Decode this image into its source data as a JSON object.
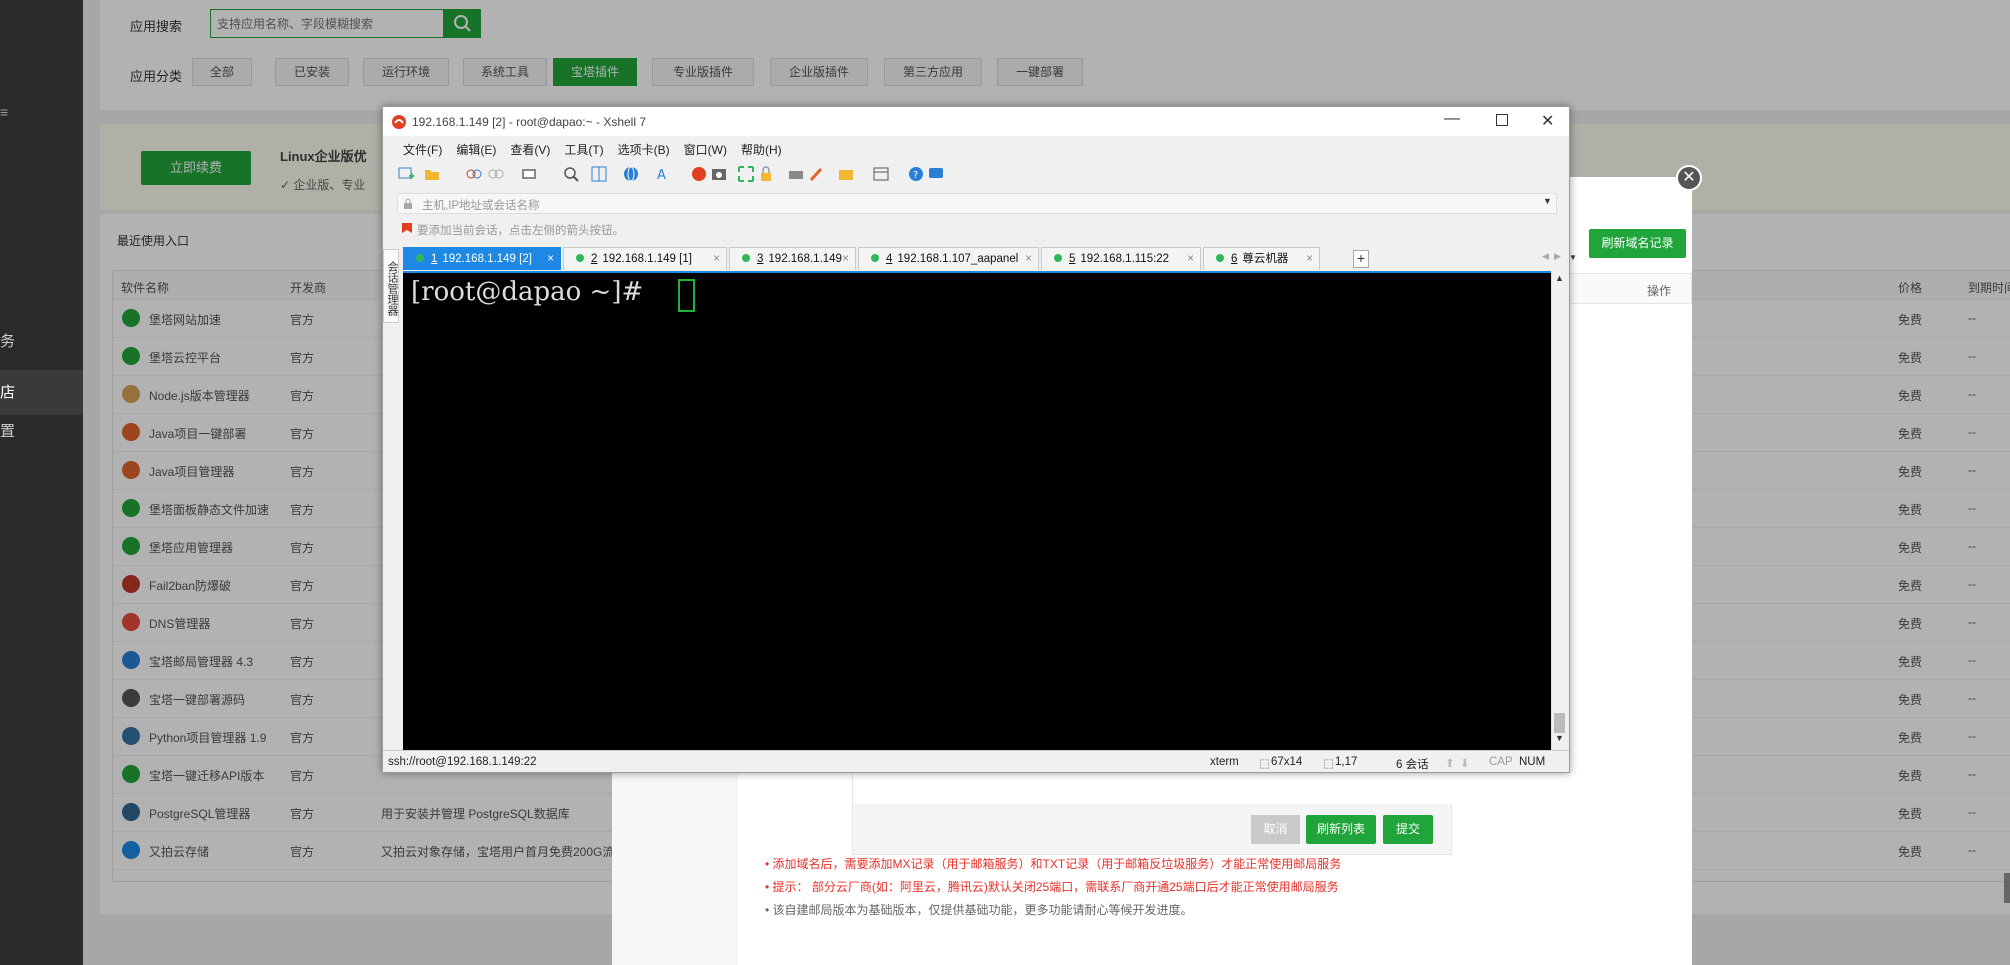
{
  "sidebar": {
    "items": [
      "务",
      "店",
      "置"
    ],
    "top_glyph": "≡"
  },
  "search": {
    "label": "应用搜索",
    "placeholder": "支持应用名称、字段模糊搜索"
  },
  "category": {
    "label": "应用分类",
    "buttons": [
      "全部",
      "已安装",
      "运行环境",
      "系统工具",
      "宝塔插件",
      "专业版插件",
      "企业版插件",
      "第三方应用",
      "一键部署"
    ],
    "active_index": 4
  },
  "promo": {
    "button": "立即续费",
    "title": "Linux企业版优",
    "sub": "✓ 企业版、专业"
  },
  "recent": {
    "label": "最近使用入口"
  },
  "table": {
    "headers": [
      "软件名称",
      "开发商"
    ],
    "right_headers": [
      "价格",
      "到期时间"
    ],
    "rows": [
      {
        "name": "堡塔网站加速",
        "dev": "官方",
        "desc": "",
        "price": "免费",
        "expire": "--",
        "color": "#20a53a"
      },
      {
        "name": "堡塔云控平台",
        "dev": "官方",
        "desc": "",
        "price": "免费",
        "expire": "--",
        "color": "#20a53a"
      },
      {
        "name": "Node.js版本管理器",
        "dev": "官方",
        "desc": "",
        "price": "免费",
        "expire": "--",
        "color": "#d7a35a"
      },
      {
        "name": "Java项目一键部署",
        "dev": "官方",
        "desc": "",
        "price": "免费",
        "expire": "--",
        "color": "#e0642c"
      },
      {
        "name": "Java项目管理器",
        "dev": "官方",
        "desc": "",
        "price": "免费",
        "expire": "--",
        "color": "#e0642c"
      },
      {
        "name": "堡塔面板静态文件加速",
        "dev": "官方",
        "desc": "",
        "price": "免费",
        "expire": "--",
        "color": "#20a53a"
      },
      {
        "name": "堡塔应用管理器",
        "dev": "官方",
        "desc": "",
        "price": "免费",
        "expire": "--",
        "color": "#20a53a"
      },
      {
        "name": "Fail2ban防爆破",
        "dev": "官方",
        "desc": "",
        "price": "免费",
        "expire": "--",
        "color": "#c0392b"
      },
      {
        "name": "DNS管理器",
        "dev": "官方",
        "desc": "",
        "price": "免费",
        "expire": "--",
        "color": "#e74c3c"
      },
      {
        "name": "宝塔邮局管理器 4.3",
        "dev": "官方",
        "desc": "",
        "price": "免费",
        "expire": "--",
        "color": "#2a7fd4"
      },
      {
        "name": "宝塔一键部署源码",
        "dev": "官方",
        "desc": "",
        "price": "免费",
        "expire": "--",
        "color": "#555555"
      },
      {
        "name": "Python项目管理器 1.9",
        "dev": "官方",
        "desc": "",
        "price": "免费",
        "expire": "--",
        "color": "#3572a5"
      },
      {
        "name": "宝塔一键迁移API版本",
        "dev": "官方",
        "desc": "",
        "price": "免费",
        "expire": "--",
        "color": "#20a53a"
      },
      {
        "name": "PostgreSQL管理器",
        "dev": "官方",
        "desc": "用于安装并管理 PostgreSQL数据库",
        "price": "免费",
        "expire": "--",
        "color": "#336791"
      },
      {
        "name": "又拍云存储",
        "dev": "官方",
        "desc": "又拍云对象存储，宝塔用户首月免费200G流",
        "price": "免费",
        "expire": "--",
        "color": "#1e88e5"
      }
    ]
  },
  "dialog": {
    "refresh_domain": "刷新域名记录",
    "op_header": "操作",
    "buttons": {
      "cancel": "取消",
      "refresh": "刷新列表",
      "submit": "提交"
    },
    "notes": [
      {
        "text": "添加域名后，需要添加MX记录（用于邮箱服务）和TXT记录（用于邮箱反垃圾服务）才能正常使用邮局服务",
        "color": "#e6312b"
      },
      {
        "text": "提示：  部分云厂商(如：阿里云，腾讯云)默认关闭25端口，需联系厂商开通25端口后才能正常使用邮局服务",
        "color": "#e6312b"
      },
      {
        "text": "该自建邮局版本为基础版本，仅提供基础功能，更多功能请耐心等候开发进度。",
        "color": "#666666"
      }
    ]
  },
  "xshell": {
    "title": "192.168.1.149 [2] - root@dapao:~ - Xshell 7",
    "menu": [
      "文件(F)",
      "编辑(E)",
      "查看(V)",
      "工具(T)",
      "选项卡(B)",
      "窗口(W)",
      "帮助(H)"
    ],
    "address_placeholder": "主机,IP地址或会话名称",
    "hint": "要添加当前会话，点击左侧的箭头按钮。",
    "side_tab": "会话管理器",
    "tabs": [
      {
        "num": "1",
        "label": "192.168.1.149 [2]",
        "active": true
      },
      {
        "num": "2",
        "label": "192.168.1.149 [1]",
        "active": false
      },
      {
        "num": "3",
        "label": "192.168.1.149",
        "active": false
      },
      {
        "num": "4",
        "label": "192.168.1.107_aapanel",
        "active": false
      },
      {
        "num": "5",
        "label": "192.168.1.115:22",
        "active": false
      },
      {
        "num": "6",
        "label": "尊云机器",
        "active": false
      }
    ],
    "prompt": "[root@dapao ~]# ",
    "status": {
      "conn": "ssh://root@192.168.1.149:22",
      "term": "xterm",
      "size": "67x14",
      "pos": "1,17",
      "sessions": "6 会话",
      "cap": "CAP",
      "num": "NUM"
    }
  }
}
